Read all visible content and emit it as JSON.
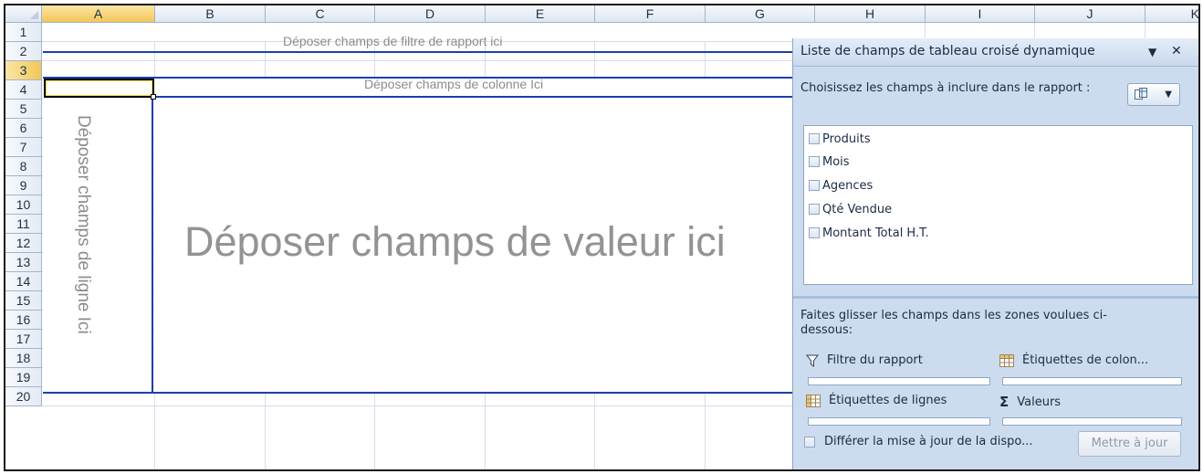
{
  "columns": [
    "A",
    "B",
    "C",
    "D",
    "E",
    "F",
    "G",
    "H",
    "I",
    "J",
    "K"
  ],
  "selected_column": "A",
  "rows": [
    "1",
    "2",
    "3",
    "4",
    "5",
    "6",
    "7",
    "8",
    "9",
    "10",
    "11",
    "12",
    "13",
    "14",
    "15",
    "16",
    "17",
    "18",
    "19",
    "20"
  ],
  "selected_row": "3",
  "pivot_placeholders": {
    "filter": "Déposer champs de filtre de rapport ici",
    "columns": "Déposer champs de colonne Ici",
    "values": "Déposer champs de valeur ici",
    "rows": "Déposer champs de ligne Ici"
  },
  "task_pane": {
    "title": "Liste de champs de tableau croisé dynamique",
    "dropdown_glyph": "▼",
    "close_glyph": "✕",
    "choose_fields_text": "Choisissez les champs à inclure dans le rapport :",
    "fields": [
      {
        "label": "Produits",
        "checked": false
      },
      {
        "label": "Mois",
        "checked": false
      },
      {
        "label": "Agences",
        "checked": false
      },
      {
        "label": "Qté Vendue",
        "checked": false
      },
      {
        "label": "Montant Total H.T.",
        "checked": false
      }
    ],
    "drag_instruction": "Faites glisser les champs dans les zones voulues ci-dessous:",
    "zones": {
      "report_filter": "Filtre du rapport",
      "column_labels": "Étiquettes de colon...",
      "row_labels": "Étiquettes de lignes",
      "values": "Valeurs"
    },
    "defer_label": "Différer la mise à jour de la dispo...",
    "update_button": "Mettre à jour"
  },
  "icons": {
    "layout_button": "field-layout-icon",
    "filter": "funnel-icon",
    "column_labels": "column-grid-icon",
    "row_labels": "row-grid-icon",
    "values": "sigma-icon"
  },
  "colors": {
    "pivot_border": "#1d3fb0",
    "pane_background": "#ccdcee",
    "selection_header": "#f3c658"
  }
}
